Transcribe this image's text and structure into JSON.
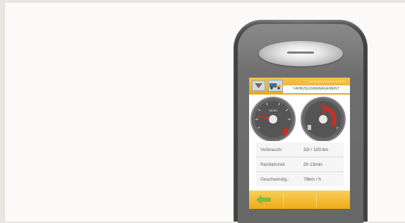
{
  "screen": {
    "top_bar": {
      "subtitle": "FAHRZEUGMANAGEMENT",
      "title": "FAHRZEUGMANAGEMENT"
    },
    "gauges": {
      "tachometer": {
        "label": "TACHO"
      },
      "fuel": {
        "label": ""
      }
    },
    "info_rows": [
      {
        "label": "Verbrauch:",
        "value": "32l / 100 km"
      },
      {
        "label": "Restfahrzeit",
        "value": "2h 13min"
      },
      {
        "label": "Geschwindig.:",
        "value": "79km / h"
      }
    ],
    "bottom_bar": {
      "back_icon": "back-arrow-icon"
    }
  },
  "colors": {
    "accent_orange": "#eeaa1f",
    "accent_red": "#d42a1f",
    "arrow_green": "#7bbf3a",
    "device_gray": "#5e5e5e"
  }
}
